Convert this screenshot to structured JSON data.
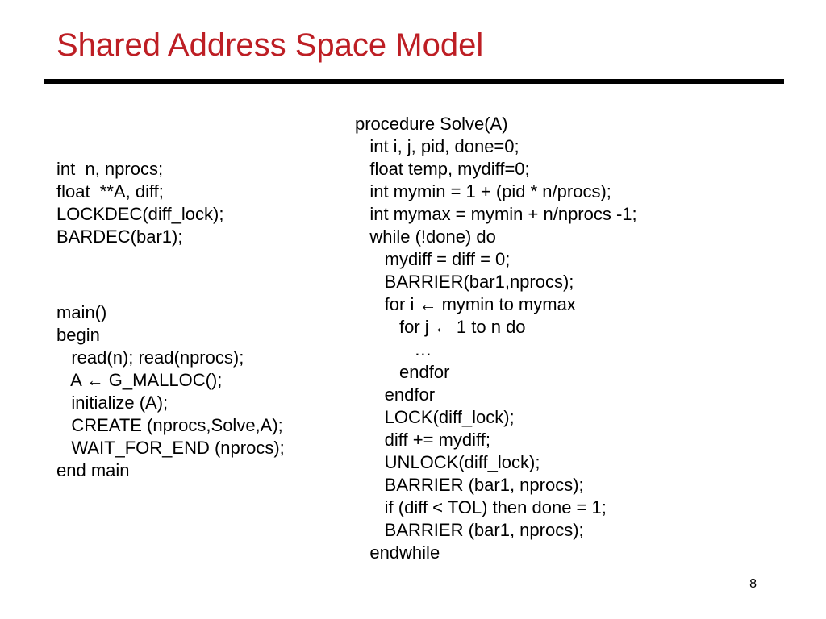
{
  "title": "Shared Address Space Model",
  "page_number": "8",
  "left_block_1": "int  n, nprocs;\nfloat  **A, diff;\nLOCKDEC(diff_lock);\nBARDEC(bar1);",
  "left_block_2": "main()\nbegin\n   read(n); read(nprocs);\n   A ← G_MALLOC();\n   initialize (A);\n   CREATE (nprocs,Solve,A);\n   WAIT_FOR_END (nprocs);\nend main",
  "right_block": "procedure Solve(A)\n   int i, j, pid, done=0;\n   float temp, mydiff=0;\n   int mymin = 1 + (pid * n/procs);\n   int mymax = mymin + n/nprocs -1;\n   while (!done) do\n      mydiff = diff = 0;\n      BARRIER(bar1,nprocs);\n      for i ← mymin to mymax\n         for j ← 1 to n do\n            …\n         endfor\n      endfor\n      LOCK(diff_lock);\n      diff += mydiff;\n      UNLOCK(diff_lock);\n      BARRIER (bar1, nprocs);\n      if (diff < TOL) then done = 1;\n      BARRIER (bar1, nprocs);\n   endwhile"
}
